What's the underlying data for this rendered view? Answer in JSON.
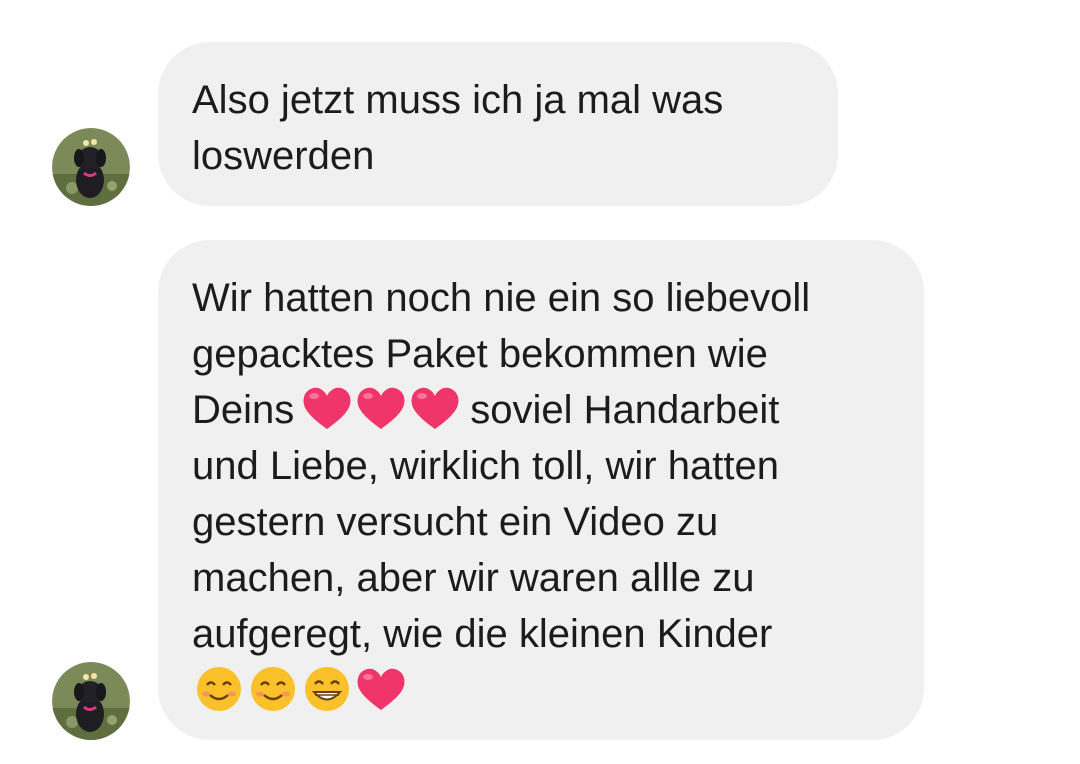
{
  "messages": [
    {
      "sender_avatar": "dog-avatar",
      "lines": [
        "Also jetzt muss ich ja mal was",
        "loswerden"
      ]
    },
    {
      "sender_avatar": "dog-avatar",
      "lines": [
        "Wir hatten noch nie ein so liebevoll",
        "gepacktes Paket bekommen wie",
        "Deins",
        "soviel Handarbeit",
        "und Liebe, wirklich toll, wir hatten",
        "gestern versucht ein Video zu",
        "machen, aber wir waren allle zu",
        "aufgeregt, wie die kleinen Kinder"
      ],
      "emojis_inline": [
        "heart",
        "heart",
        "heart"
      ],
      "emojis_end": [
        "smiling-face",
        "smiling-face",
        "grinning-face",
        "heart"
      ]
    }
  ],
  "colors": {
    "bubble_bg": "#f0f0f0",
    "text": "#1c1c1c",
    "heart": "#f0356b",
    "emoji_face": "#fbc12a"
  }
}
